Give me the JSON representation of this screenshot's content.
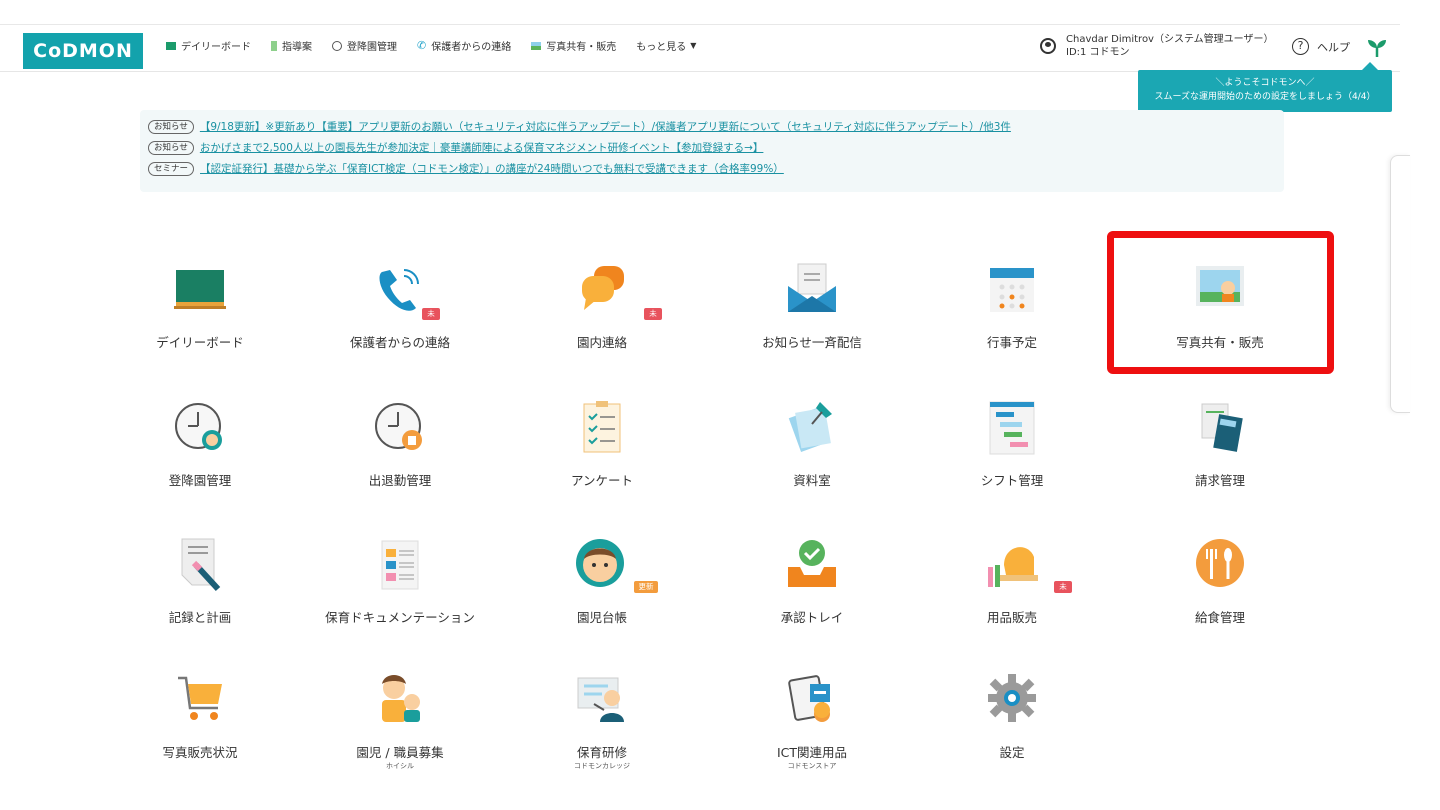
{
  "header": {
    "logo_text": "CoDMON",
    "nav": [
      {
        "label": "デイリーボード",
        "icon": "board-icon"
      },
      {
        "label": "指導案",
        "icon": "document-icon"
      },
      {
        "label": "登降園管理",
        "icon": "clock-icon"
      },
      {
        "label": "保護者からの連絡",
        "icon": "phone-icon"
      },
      {
        "label": "写真共有・販売",
        "icon": "photo-icon"
      },
      {
        "label": "もっと見る",
        "icon": "caret-down-icon"
      }
    ],
    "user_name": "Chavdar Dimitrov（システム管理ユーザー）",
    "user_id": "ID:1 コドモン",
    "help_label": "ヘルプ"
  },
  "tooltip": {
    "line1": "＼ようこそコドモンへ／",
    "line2": "スムーズな運用開始のための設定をしましょう（4/4）"
  },
  "notices": [
    {
      "badge": "お知らせ",
      "text": "【9/18更新】※更新あり【重要】アプリ更新のお願い（セキュリティ対応に伴うアップデート）/保護者アプリ更新について（セキュリティ対応に伴うアップデート）/他3件"
    },
    {
      "badge": "お知らせ",
      "text": "おかげさまで2,500人以上の園長先生が参加決定｜豪華講師陣による保育マネジメント研修イベント【参加登録する→】"
    },
    {
      "badge": "セミナー",
      "text": "【認定証発行】基礎から学ぶ「保育ICT検定（コドモン検定）」の講座が24時間いつでも無料で受講できます（合格率99%）"
    }
  ],
  "tiles": {
    "daily_board": {
      "label": "デイリーボード"
    },
    "parent_contact": {
      "label": "保護者からの連絡",
      "tag": "未"
    },
    "internal_contact": {
      "label": "園内連絡",
      "tag": "未"
    },
    "broadcast": {
      "label": "お知らせ一斉配信"
    },
    "events": {
      "label": "行事予定"
    },
    "photos": {
      "label": "写真共有・販売"
    },
    "attendance": {
      "label": "登降園管理"
    },
    "staff_attendance": {
      "label": "出退勤管理"
    },
    "survey": {
      "label": "アンケート"
    },
    "library": {
      "label": "資料室"
    },
    "shift": {
      "label": "シフト管理"
    },
    "billing": {
      "label": "請求管理"
    },
    "records": {
      "label": "記録と計画"
    },
    "documentation": {
      "label": "保育ドキュメンテーション"
    },
    "children": {
      "label": "園児台帳",
      "tag": "更新"
    },
    "approval": {
      "label": "承認トレイ"
    },
    "goods": {
      "label": "用品販売",
      "tag": "未"
    },
    "meals": {
      "label": "給食管理"
    },
    "photo_sales": {
      "label": "写真販売状況"
    },
    "recruit": {
      "label": "園児 / 職員募集",
      "sub": "ホイシル"
    },
    "training": {
      "label": "保育研修",
      "sub": "コドモンカレッジ"
    },
    "ict": {
      "label": "ICT関連用品",
      "sub": "コドモンストア"
    },
    "settings": {
      "label": "設定"
    }
  }
}
